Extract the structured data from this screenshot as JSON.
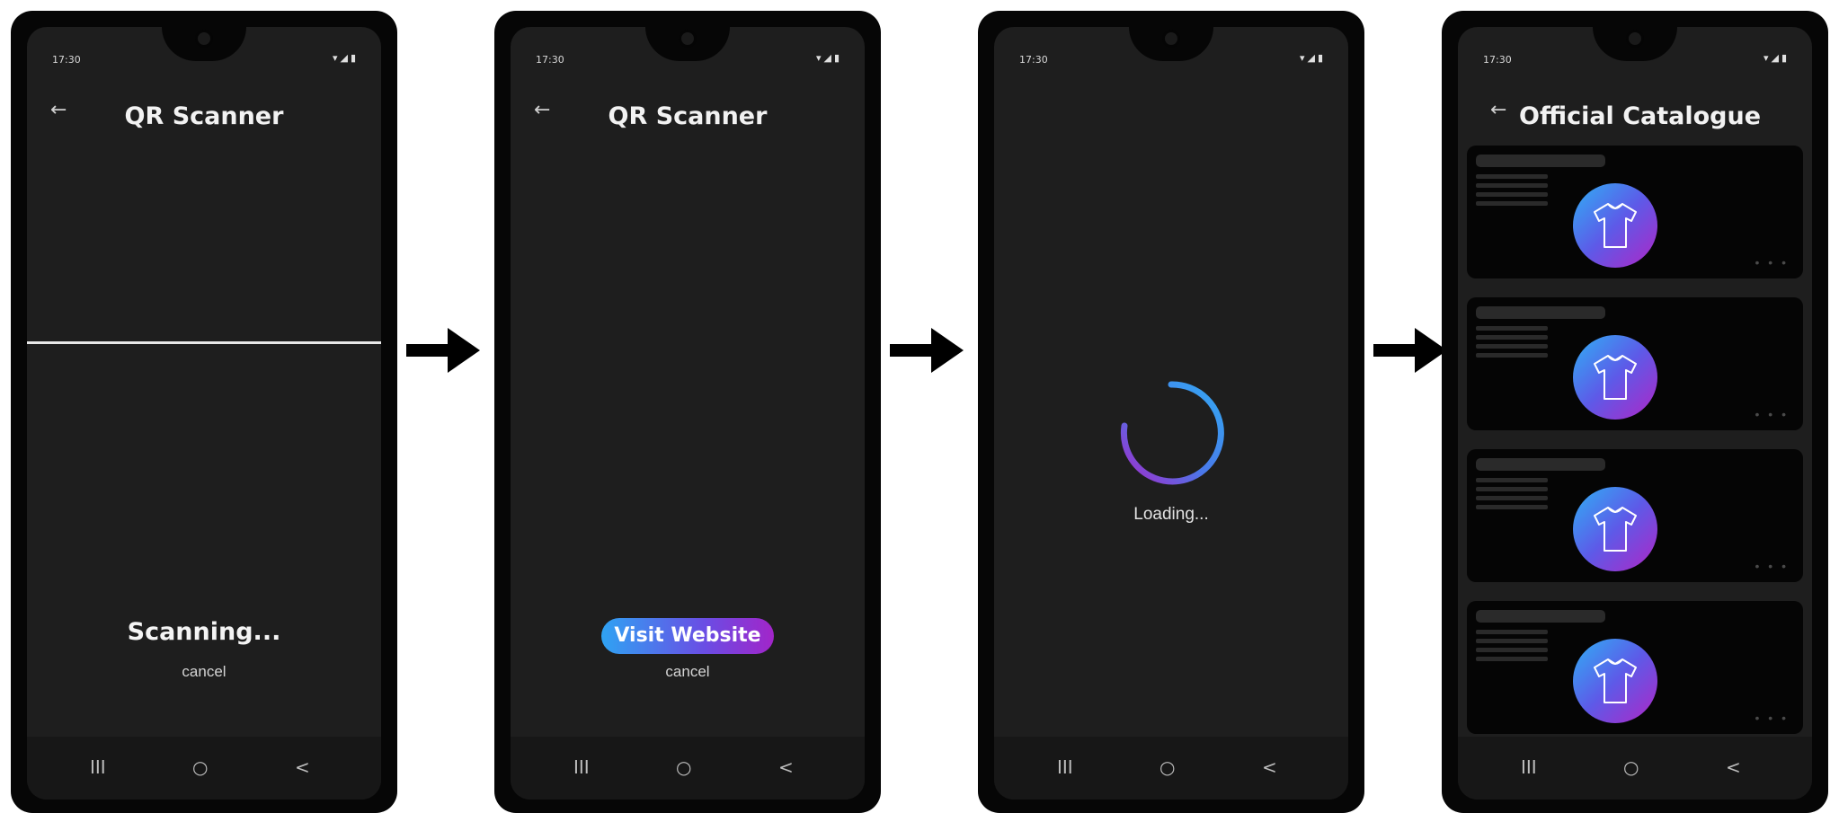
{
  "status": {
    "time": "17:30",
    "icons": [
      "wifi-icon",
      "signal-icon",
      "battery-icon"
    ]
  },
  "nav": {
    "icons": [
      "recent-apps-icon",
      "home-icon",
      "back-icon"
    ],
    "recent": "III",
    "home": "○",
    "back": "<"
  },
  "scanner": {
    "title": "QR Scanner",
    "back_glyph": "←"
  },
  "step1": {
    "status": "Scanning...",
    "cancel": "cancel"
  },
  "step2": {
    "button": "Visit Website",
    "cancel": "cancel"
  },
  "step3": {
    "loading": "Loading..."
  },
  "step4": {
    "title": "Official Catalogue",
    "back_glyph": "←",
    "cards": [
      {
        "dots": "• • •"
      },
      {
        "dots": "• • •"
      },
      {
        "dots": "• • •"
      },
      {
        "dots": "• • •"
      }
    ]
  },
  "colors": {
    "phone_frame": "#060606",
    "screen": "#1e1e1e",
    "card": "#050505",
    "gradient_start": "#2fa3f3",
    "gradient_mid": "#6a4de4",
    "gradient_end": "#a225c9"
  }
}
